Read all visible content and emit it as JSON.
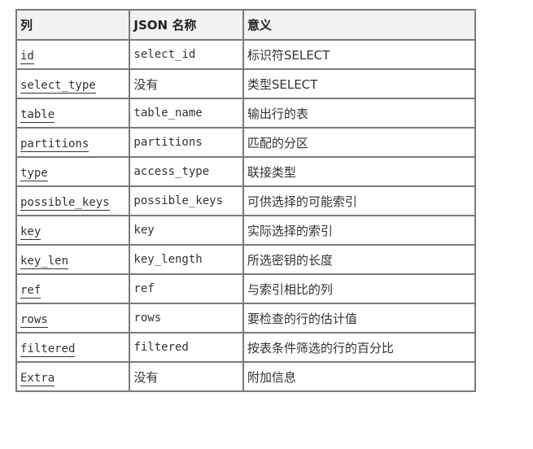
{
  "table": {
    "headers": [
      "列",
      "JSON 名称",
      "意义"
    ],
    "rows": [
      {
        "column": "id",
        "json_name": "select_id",
        "meaning": "标识符SELECT"
      },
      {
        "column": "select_type",
        "json_name": "没有",
        "meaning": "类型SELECT"
      },
      {
        "column": "table",
        "json_name": "table_name",
        "meaning": "输出行的表"
      },
      {
        "column": "partitions",
        "json_name": "partitions",
        "meaning": "匹配的分区"
      },
      {
        "column": "type",
        "json_name": "access_type",
        "meaning": "联接类型"
      },
      {
        "column": "possible_keys",
        "json_name": "possible_keys",
        "meaning": "可供选择的可能索引"
      },
      {
        "column": "key",
        "json_name": "key",
        "meaning": "实际选择的索引"
      },
      {
        "column": "key_len",
        "json_name": "key_length",
        "meaning": "所选密钥的长度"
      },
      {
        "column": "ref",
        "json_name": "ref",
        "meaning": "与索引相比的列"
      },
      {
        "column": "rows",
        "json_name": "rows",
        "meaning": "要检查的行的估计值"
      },
      {
        "column": "filtered",
        "json_name": "filtered",
        "meaning": "按表条件筛选的行的百分比"
      },
      {
        "column": "Extra",
        "json_name": "没有",
        "meaning": "附加信息"
      }
    ]
  }
}
